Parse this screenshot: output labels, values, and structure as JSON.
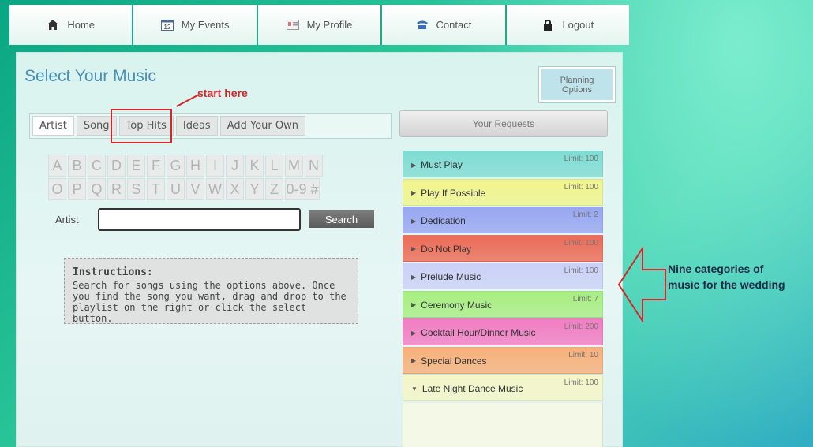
{
  "nav": [
    {
      "label": "Home",
      "icon": "home-icon"
    },
    {
      "label": "My Events",
      "icon": "calendar-icon"
    },
    {
      "label": "My Profile",
      "icon": "profile-card-icon"
    },
    {
      "label": "Contact",
      "icon": "phone-icon"
    },
    {
      "label": "Logout",
      "icon": "lock-icon"
    }
  ],
  "page_title": "Select Your Music",
  "planning_button": "Planning Options",
  "annotations": {
    "start": "start here",
    "categories_line1": "Nine categories of",
    "categories_line2": "music for the wedding"
  },
  "tabs": [
    {
      "label": "Artist",
      "active": true
    },
    {
      "label": "Song",
      "active": false
    },
    {
      "label": "Top Hits",
      "active": false
    },
    {
      "label": "Ideas",
      "active": false
    },
    {
      "label": "Add Your Own",
      "active": false
    }
  ],
  "letters_row1": [
    "A",
    "B",
    "C",
    "D",
    "E",
    "F",
    "G",
    "H",
    "I",
    "J",
    "K",
    "L",
    "M",
    "N"
  ],
  "letters_row2": [
    "O",
    "P",
    "Q",
    "R",
    "S",
    "T",
    "U",
    "V",
    "W",
    "X",
    "Y",
    "Z",
    "0-9 #"
  ],
  "search": {
    "label": "Artist",
    "value": "",
    "button": "Search"
  },
  "instructions": {
    "title": "Instructions:",
    "body": "Search for songs using the options above. Once you find the song you want, drag and drop to the playlist on the right or click the select button."
  },
  "requests_header": "Your Requests",
  "categories": [
    {
      "label": "Must Play",
      "limit": "Limit: 100",
      "color": "#7fdcd3",
      "expanded": false
    },
    {
      "label": "Play If Possible",
      "limit": "Limit: 100",
      "color": "#f1f58c",
      "expanded": false
    },
    {
      "label": "Dedication",
      "limit": "Limit: 2",
      "color": "#98a6f2",
      "expanded": false
    },
    {
      "label": "Do Not Play",
      "limit": "Limit: 100",
      "color": "#ec6a56",
      "expanded": false
    },
    {
      "label": "Prelude Music",
      "limit": "Limit: 100",
      "color": "#cbd1f7",
      "expanded": false
    },
    {
      "label": "Ceremony Music",
      "limit": "Limit: 7",
      "color": "#a8ee82",
      "expanded": false
    },
    {
      "label": "Cocktail Hour/Dinner Music",
      "limit": "Limit: 200",
      "color": "#f27cc2",
      "expanded": false
    },
    {
      "label": "Special Dances",
      "limit": "Limit: 10",
      "color": "#f7b07a",
      "expanded": false
    },
    {
      "label": "Late Night Dance Music",
      "limit": "Limit: 100",
      "color": "#f4f6c8",
      "expanded": true
    }
  ]
}
